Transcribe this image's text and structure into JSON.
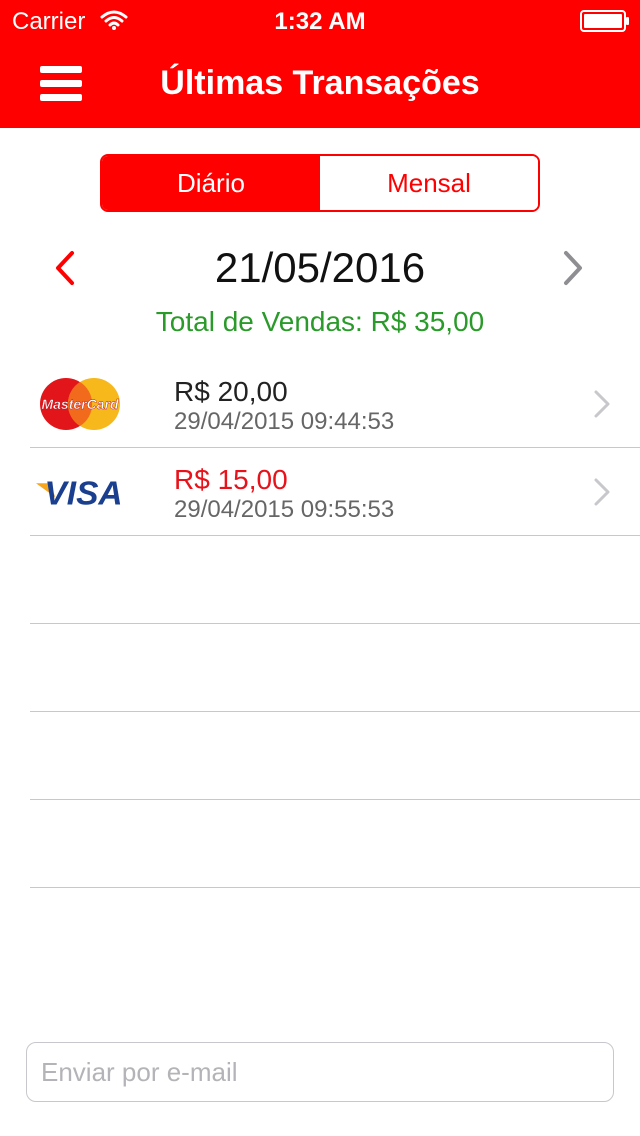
{
  "status_bar": {
    "carrier": "Carrier",
    "time": "1:32 AM"
  },
  "nav": {
    "title": "Últimas Transações",
    "menu_icon": "hamburger-menu-icon"
  },
  "segmented": {
    "options": [
      {
        "label": "Diário",
        "selected": true
      },
      {
        "label": "Mensal",
        "selected": false
      }
    ]
  },
  "date_nav": {
    "date": "21/05/2016"
  },
  "summary": {
    "total_text": "Total de Vendas: R$ 35,00"
  },
  "transactions": [
    {
      "brand": "MasterCard",
      "amount": "R$ 20,00",
      "datetime": "29/04/2015 09:44:53",
      "amount_color": "#222222"
    },
    {
      "brand": "VISA",
      "amount": "R$ 15,00",
      "datetime": "29/04/2015 09:55:53",
      "amount_color": "#e8121a"
    }
  ],
  "email": {
    "placeholder": "Enviar por e-mail",
    "value": ""
  },
  "colors": {
    "primary": "#fe0000",
    "total_green": "#2a9a2a",
    "separator": "#c8c8cc"
  }
}
